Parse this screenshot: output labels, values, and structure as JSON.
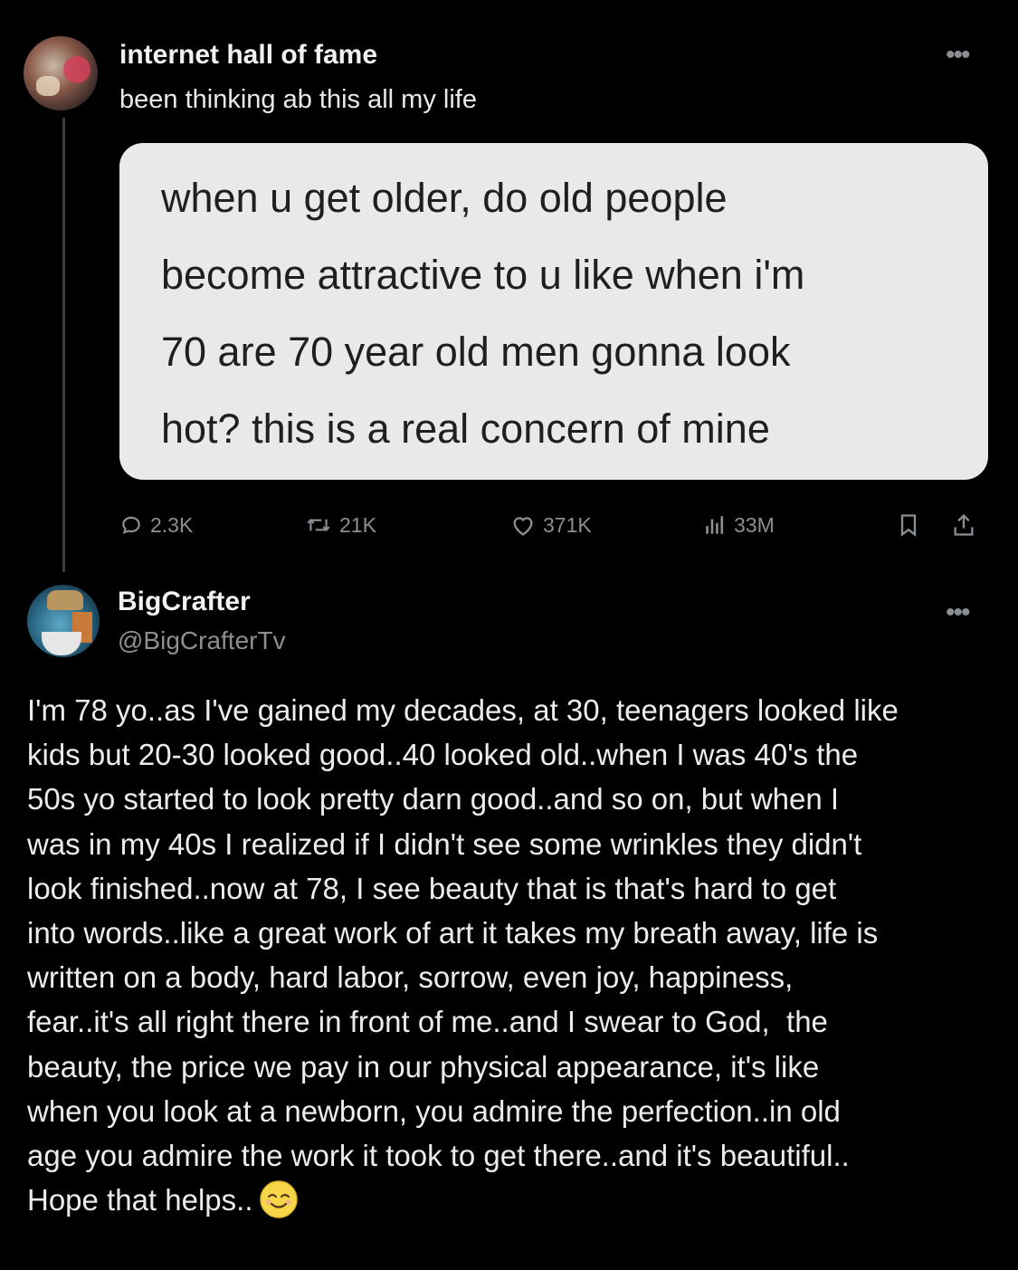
{
  "post1": {
    "author_name": "internet hall of fame",
    "text": "been thinking ab this all my life",
    "quote_lines": [
      "when u get older, do old people",
      "become attractive to u like when i'm",
      "70 are 70 year old men gonna look",
      "hot? this is a real concern of mine"
    ],
    "actions": {
      "replies": "2.3K",
      "reposts": "21K",
      "likes": "371K",
      "views": "33M"
    },
    "icons": {
      "reply": "reply-bubble-icon",
      "repost": "repost-arrows-icon",
      "like": "heart-icon",
      "views": "bar-chart-icon",
      "bookmark": "bookmark-icon",
      "share": "share-icon",
      "more": "more-dots-icon"
    }
  },
  "post2": {
    "author_name": "BigCrafter",
    "handle": "@BigCrafterTv",
    "body_lines": [
      "I'm 78 yo..as I've gained my decades, at 30, teenagers looked like",
      "kids but 20-30 looked good..40 looked old..when I was 40's the",
      "50s yo started to look pretty darn good..and so on, but when I",
      "was in my 40s I realized if I didn't see some wrinkles they didn't",
      "look finished..now at 78, I see beauty that is that's hard to get",
      "into words..like a great work of art it takes my breath away, life is",
      "written on a body, hard labor, sorrow, even joy, happiness,",
      "fear..it's all right there in front of me..and I swear to God,  the",
      "beauty, the price we pay in our physical appearance, it's like",
      "when you look at a newborn, you admire the perfection..in old",
      "age you admire the work it took to get there..and it's beautiful..",
      "Hope that helps.."
    ],
    "emoji": "relieved-face-emoji"
  },
  "colors": {
    "background": "#000000",
    "text": "#e7e9ea",
    "muted": "#8b8f93",
    "card": "#e9e9e9",
    "card_text": "#1f1f1f"
  }
}
